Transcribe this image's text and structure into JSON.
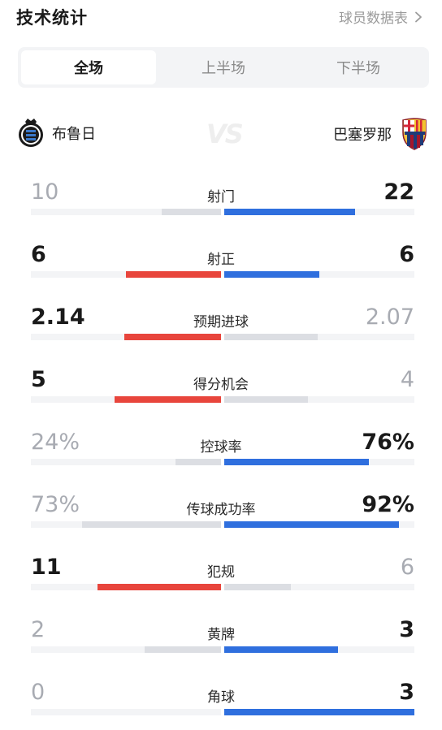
{
  "header": {
    "title": "技术统计",
    "link_label": "球员数据表"
  },
  "tabs": [
    {
      "label": "全场",
      "active": true
    },
    {
      "label": "上半场",
      "active": false
    },
    {
      "label": "下半场",
      "active": false
    }
  ],
  "teams": {
    "home": {
      "name": "布鲁日",
      "icon": "club-brugge-crest-icon"
    },
    "away": {
      "name": "巴塞罗那",
      "icon": "fc-barcelona-crest-icon"
    },
    "vs_label": "VS"
  },
  "colors": {
    "home_lead": "#e8453c",
    "away_lead": "#2f6fde",
    "trailing": "#dcdee3",
    "track": "#f3f4f6"
  },
  "stats": [
    {
      "label": "射门",
      "home": "10",
      "away": "22",
      "home_bar": 0.31,
      "away_bar": 0.69,
      "leader": "away"
    },
    {
      "label": "射正",
      "home": "6",
      "away": "6",
      "home_bar": 0.5,
      "away_bar": 0.5,
      "leader": "both"
    },
    {
      "label": "预期进球",
      "home": "2.14",
      "away": "2.07",
      "home_bar": 0.51,
      "away_bar": 0.49,
      "leader": "home"
    },
    {
      "label": "得分机会",
      "home": "5",
      "away": "4",
      "home_bar": 0.56,
      "away_bar": 0.44,
      "leader": "home"
    },
    {
      "label": "控球率",
      "home": "24%",
      "away": "76%",
      "home_bar": 0.24,
      "away_bar": 0.76,
      "leader": "away"
    },
    {
      "label": "传球成功率",
      "home": "73%",
      "away": "92%",
      "home_bar": 0.73,
      "away_bar": 0.92,
      "leader": "away"
    },
    {
      "label": "犯规",
      "home": "11",
      "away": "6",
      "home_bar": 0.65,
      "away_bar": 0.35,
      "leader": "home"
    },
    {
      "label": "黄牌",
      "home": "2",
      "away": "3",
      "home_bar": 0.4,
      "away_bar": 0.6,
      "leader": "away"
    },
    {
      "label": "角球",
      "home": "0",
      "away": "3",
      "home_bar": 0.0,
      "away_bar": 1.0,
      "leader": "away"
    }
  ]
}
